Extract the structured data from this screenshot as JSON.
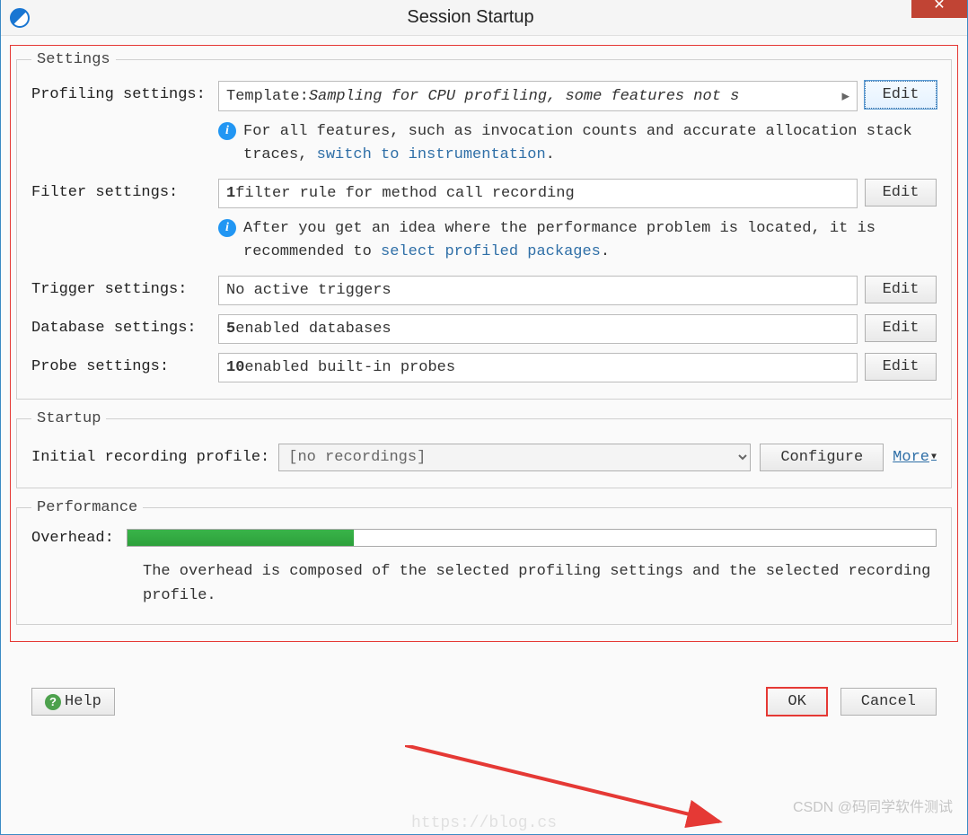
{
  "window": {
    "title": "Session Startup",
    "close_label": "✕"
  },
  "settings": {
    "legend": "Settings",
    "profiling": {
      "label": "Profiling settings:",
      "template_prefix": "Template: ",
      "template_value": "Sampling for CPU profiling, some features not s",
      "edit_label": "Edit",
      "info_text_1": "For all features, such as invocation counts and accurate allocation stack traces, ",
      "info_link": "switch to instrumentation",
      "info_period": "."
    },
    "filter": {
      "label": "Filter settings:",
      "value_bold": "1",
      "value_rest": " filter rule for method call recording",
      "edit_label": "Edit",
      "info_text_1": "After you get an idea where the performance problem is located, it is recommended to ",
      "info_link": "select profiled packages",
      "info_period": "."
    },
    "trigger": {
      "label": "Trigger settings:",
      "value": "No active triggers",
      "edit_label": "Edit"
    },
    "database": {
      "label": "Database settings:",
      "value_bold": "5",
      "value_rest": " enabled databases",
      "edit_label": "Edit"
    },
    "probe": {
      "label": "Probe settings:",
      "value_bold": "10",
      "value_rest": " enabled built-in probes",
      "edit_label": "Edit"
    }
  },
  "startup": {
    "legend": "Startup",
    "label": "Initial recording profile:",
    "selected": "[no recordings]",
    "configure_label": "Configure",
    "more_label": "More"
  },
  "performance": {
    "legend": "Performance",
    "overhead_label": "Overhead:",
    "overhead_percent": 28,
    "desc": "The overhead is composed of the selected profiling settings and the selected recording profile."
  },
  "footer": {
    "help_label": "Help",
    "ok_label": "OK",
    "cancel_label": "Cancel"
  },
  "watermark": "CSDN @码同学软件测试",
  "watermark2": "https://blog.cs"
}
